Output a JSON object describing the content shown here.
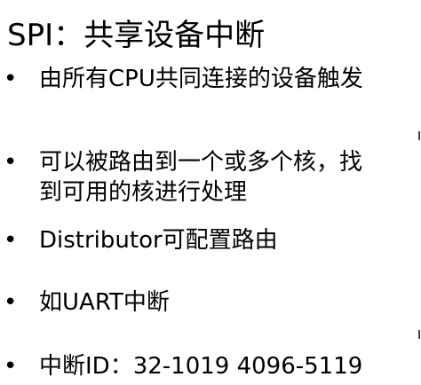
{
  "slide": {
    "title": "SPI：共享设备中断",
    "bullet_symbol": "•",
    "bullets": [
      {
        "lines": [
          "由所有CPU共同连接的设备触发"
        ]
      },
      {
        "lines": [
          "可以被路由到一个或多个核，找",
          "到可用的核进行处理"
        ]
      },
      {
        "lines": [
          "Distributor可配置路由"
        ]
      },
      {
        "lines": [
          "如UART中断"
        ]
      },
      {
        "lines": [
          "中断ID：32-1019 4096-5119"
        ]
      }
    ]
  }
}
